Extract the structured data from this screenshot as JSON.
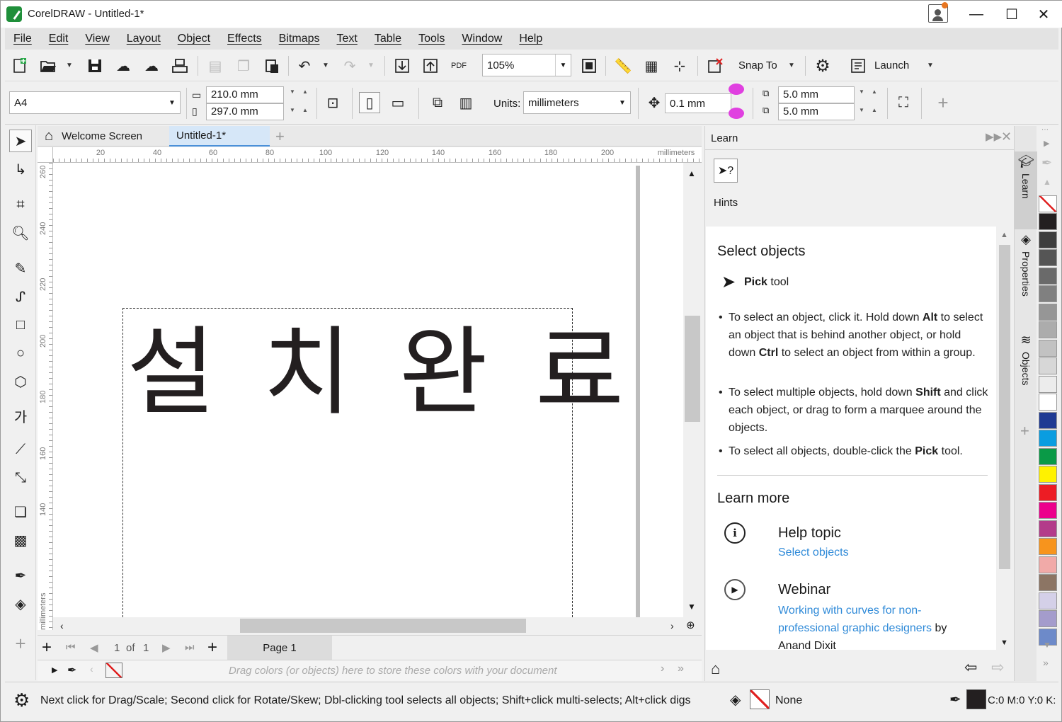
{
  "window": {
    "title": "CorelDRAW - Untitled-1*",
    "minimize": "—",
    "maximize": "☐",
    "close": "✕"
  },
  "menu": [
    "File",
    "Edit",
    "View",
    "Layout",
    "Object",
    "Effects",
    "Bitmaps",
    "Text",
    "Table",
    "Tools",
    "Window",
    "Help"
  ],
  "standard_toolbar": {
    "zoom": "105%",
    "snap_to": "Snap To",
    "launch": "Launch",
    "pdf_label": "PDF"
  },
  "property_bar": {
    "page_size": "A4",
    "width": "210.0 mm",
    "height": "297.0 mm",
    "units_label": "Units:",
    "units": "millimeters",
    "nudge": "0.1 mm",
    "dup_x": "5.0 mm",
    "dup_y": "5.0 mm"
  },
  "doc_tabs": {
    "welcome": "Welcome Screen",
    "current": "Untitled-1*"
  },
  "rulers": {
    "h_ticks": [
      "20",
      "40",
      "60",
      "80",
      "100",
      "120",
      "140",
      "160",
      "180",
      "200"
    ],
    "h_unit": "millimeters",
    "v_ticks": [
      "260",
      "240",
      "220",
      "200",
      "180",
      "160",
      "140"
    ],
    "v_unit": "millimeters"
  },
  "canvas": {
    "text": "설 치 완 료"
  },
  "page_nav": {
    "current": "1",
    "of_label": "of",
    "total": "1",
    "page_tab": "Page 1"
  },
  "doc_palette": {
    "hint": "Drag colors (or objects) here to store these colors with your document"
  },
  "learn_panel": {
    "title": "Learn",
    "hints_label": "Hints",
    "heading": "Select objects",
    "tool_bold": "Pick",
    "tool_rest": " tool",
    "bullets": [
      {
        "a": "To select an object, click it. Hold down ",
        "b": "Alt",
        "c": " to select an object that is behind another object, or hold down ",
        "d": "Ctrl",
        "e": " to select an object from within a group."
      },
      {
        "a": "To select multiple objects, hold down ",
        "b": "Shift",
        "c": " and click each object, or drag to form a marquee around the objects."
      },
      {
        "a": "To select all objects, double-click the ",
        "b": "Pick",
        "c": " tool."
      }
    ],
    "learn_more": "Learn more",
    "help_topic_title": "Help topic",
    "help_topic_link": "Select objects",
    "webinar_title": "Webinar",
    "webinar_link": "Working with curves for non-professional graphic designers",
    "webinar_by": " by",
    "webinar_author": "Anand Dixit"
  },
  "side_tabs": [
    "Learn",
    "Properties",
    "Objects"
  ],
  "palette_colors": [
    "#231f20",
    "#3d3d3d",
    "#555555",
    "#6a6a6a",
    "#808080",
    "#969696",
    "#acacac",
    "#c2c2c2",
    "#d7d7d7",
    "#ececec",
    "#ffffff",
    "#1f3a93",
    "#0a9de0",
    "#0a9a47",
    "#fff200",
    "#ed1c24",
    "#ec008c",
    "#b33b8a",
    "#f7941d",
    "#f1aaa8",
    "#8c7564",
    "#d4d0e8",
    "#a49ccc",
    "#6d8ac9"
  ],
  "status": {
    "hint": "Next click for Drag/Scale; Second click for Rotate/Skew; Dbl-clicking tool selects all objects; Shift+click multi-selects; Alt+click digs",
    "fill": "None",
    "outline_color": "C:0 M:0 Y:0 K:"
  }
}
